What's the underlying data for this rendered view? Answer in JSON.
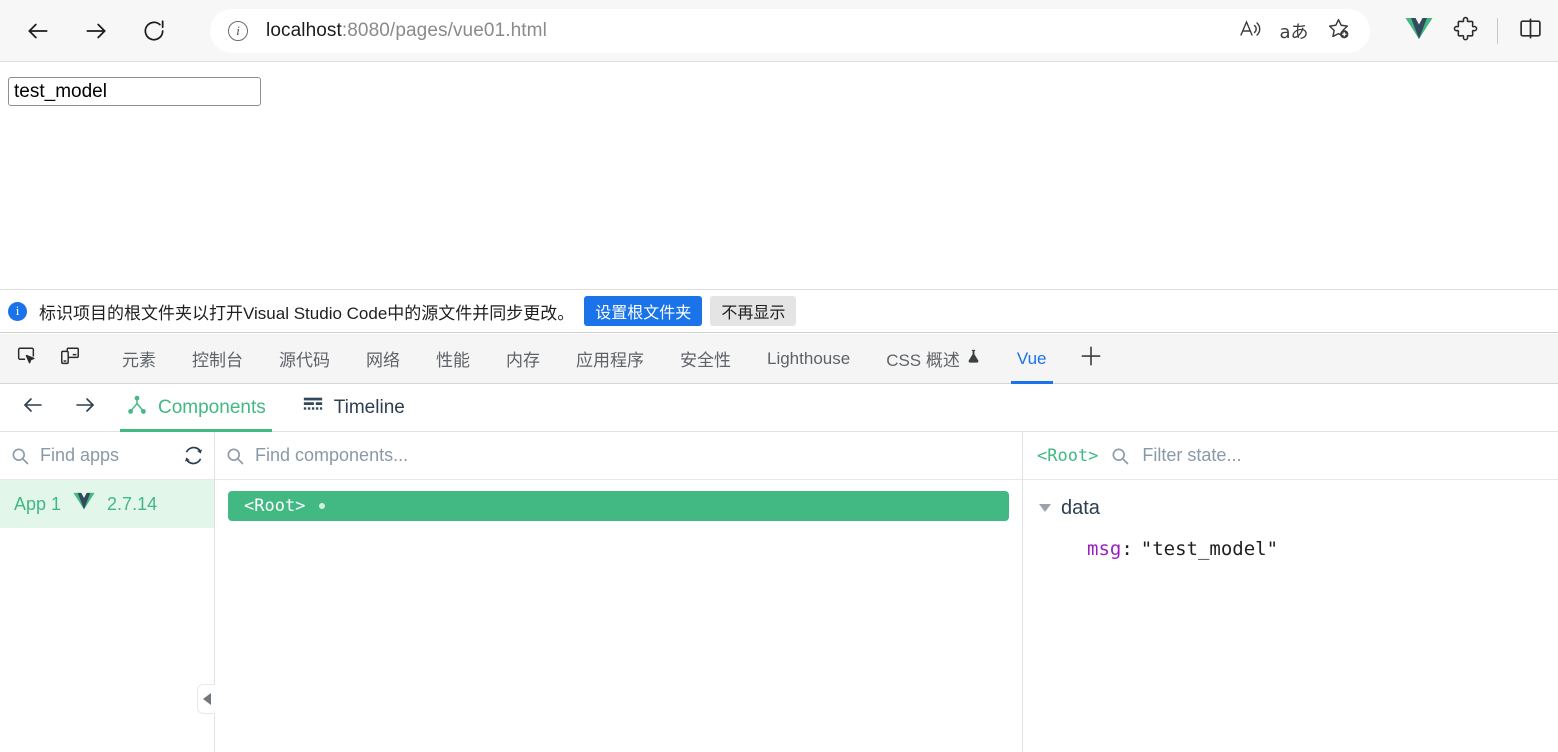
{
  "browser": {
    "back_icon": "arrow-left-icon",
    "forward_icon": "arrow-right-icon",
    "reload_icon": "reload-icon",
    "url_host": "localhost",
    "url_path": ":8080/pages/vue01.html",
    "site_info_icon": "info-circle-icon",
    "read_aloud_icon": "read-aloud-icon",
    "translate_icon": "translate-icon",
    "favorite_icon": "add-favorite-icon",
    "vue_devtools_icon": "vue-logo-icon",
    "extensions_icon": "extensions-puzzle-icon",
    "split_screen_icon": "split-screen-icon"
  },
  "page": {
    "input_value": "test_model",
    "input_placeholder": ""
  },
  "infobar": {
    "icon": "info-icon",
    "message": "标识项目的根文件夹以打开Visual Studio Code中的源文件并同步更改。",
    "primary_button": "设置根文件夹",
    "secondary_button": "不再显示"
  },
  "devtools": {
    "inspect_icon": "inspect-element-icon",
    "device_toggle_icon": "device-toolbar-icon",
    "tabs": [
      {
        "label": "元素",
        "active": false
      },
      {
        "label": "控制台",
        "active": false
      },
      {
        "label": "源代码",
        "active": false
      },
      {
        "label": "网络",
        "active": false
      },
      {
        "label": "性能",
        "active": false
      },
      {
        "label": "内存",
        "active": false
      },
      {
        "label": "应用程序",
        "active": false
      },
      {
        "label": "安全性",
        "active": false
      },
      {
        "label": "Lighthouse",
        "active": false
      },
      {
        "label": "CSS 概述",
        "active": false,
        "icon": "experiment-flask-icon"
      },
      {
        "label": "Vue",
        "active": true
      }
    ],
    "add_tab_icon": "plus-icon",
    "active_tab_color": "#1a73e8"
  },
  "vue_devtools": {
    "back_icon": "arrow-left-icon",
    "forward_icon": "arrow-right-icon",
    "subtabs": [
      {
        "label": "Components",
        "icon": "component-tree-icon",
        "active": true
      },
      {
        "label": "Timeline",
        "icon": "timeline-icon",
        "active": false
      }
    ],
    "accent_color": "#42b883",
    "apps_pane": {
      "search_placeholder": "Find apps",
      "search_icon": "search-icon",
      "refresh_icon": "refresh-icon",
      "collapse_icon": "collapse-left-icon",
      "apps": [
        {
          "name": "App 1",
          "version": "2.7.14",
          "logo": "vue-logo-icon",
          "selected": true
        }
      ]
    },
    "components_pane": {
      "search_placeholder": "Find components...",
      "search_icon": "search-icon",
      "nodes": [
        {
          "label": "<Root>",
          "selected": true,
          "has_dot": true
        }
      ]
    },
    "state_pane": {
      "component_name": "<Root>",
      "filter_placeholder": "Filter state...",
      "search_icon": "search-icon",
      "groups": [
        {
          "name": "data",
          "expanded": true,
          "entries": [
            {
              "key": "msg",
              "separator": ":",
              "value": "\"test_model\""
            }
          ]
        }
      ]
    }
  }
}
